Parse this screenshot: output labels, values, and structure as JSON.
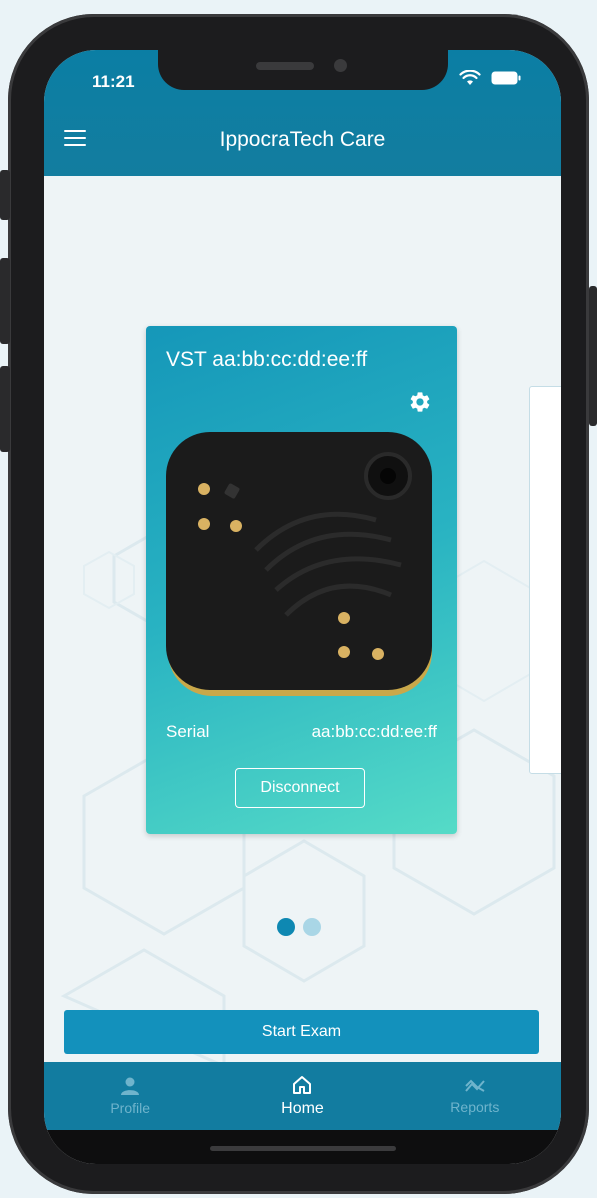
{
  "status_bar": {
    "time": "11:21"
  },
  "header": {
    "title": "IppocraTech Care",
    "menu_icon": "hamburger-menu-icon"
  },
  "device_card": {
    "title": "VST aa:bb:cc:dd:ee:ff",
    "settings_icon": "gear-icon",
    "serial_label": "Serial",
    "serial_value": "aa:bb:cc:dd:ee:ff",
    "disconnect_label": "Disconnect"
  },
  "pager": {
    "pages": 2,
    "current": 1
  },
  "start_exam_label": "Start Exam",
  "bottom_nav": {
    "items": [
      {
        "label": "Profile",
        "icon": "person-icon",
        "active": false
      },
      {
        "label": "Home",
        "icon": "home-icon",
        "active": true
      },
      {
        "label": "Reports",
        "icon": "trend-icon",
        "active": false
      }
    ]
  },
  "colors": {
    "primary": "#0f7ea3",
    "card_gradient_start": "#1597b9",
    "card_gradient_end": "#55dbc7",
    "button": "#1391bc"
  }
}
